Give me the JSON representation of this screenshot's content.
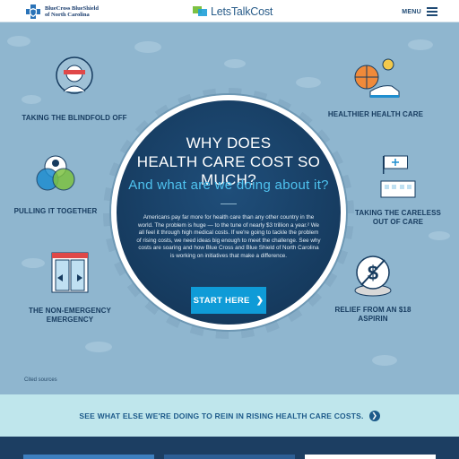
{
  "header": {
    "bcbs_logo_text": "BlueCross BlueShield\nof North Carolina",
    "site_logo_text": "LetsTalkCost",
    "menu_label": "MENU"
  },
  "hero": {
    "title_line1": "WHY DOES",
    "title_line2": "HEALTH CARE COST SO MUCH?",
    "subtitle": "And what are we doing about it?",
    "body": "Americans pay far more for health care than any other country in the world. The problem is huge — to the tune of nearly $3 trillion a year.² We all feel it through high medical costs. If we're going to tackle the problem of rising costs, we need ideas big enough to meet the challenge. See why costs are soaring and how Blue Cross and Blue Shield of North Carolina is working on initiatives that make a difference.",
    "start_label": "START HERE"
  },
  "topics": {
    "blindfold": "TAKING THE BLINDFOLD OFF",
    "together": "PULLING IT TOGETHER",
    "emergency": "THE NON-EMERGENCY EMERGENCY",
    "healthier": "HEALTHIER HEALTH CARE",
    "careless": "TAKING THE CARELESS OUT OF CARE",
    "aspirin": "RELIEF FROM AN $18 ASPIRIN"
  },
  "cited_sources": "Cited sources",
  "banner": {
    "text": "SEE WHAT ELSE WE'RE DOING TO REIN IN RISING HEALTH CARE COSTS."
  },
  "colors": {
    "hero_bg": "#8fb6cf",
    "circle_bg": "#163b5f",
    "accent": "#0f9bd7",
    "subtitle": "#4fc3f0",
    "label_text": "#163b5f",
    "banner_bg": "#bfe6ec"
  }
}
